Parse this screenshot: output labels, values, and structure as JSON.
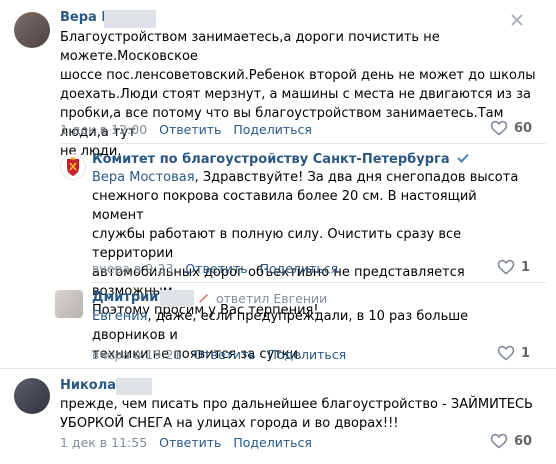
{
  "comments": [
    {
      "author": "Вера М",
      "text_lines": [
        "Благоустройством занимаетесь,а дороги почистить не можете.Московское",
        "шоссе пос.ленсоветовский.Ребенок второй день не может до школы",
        "доехать.Люди стоят мерзнут, а машины с места не двигаются из за",
        "пробки,а все потому что вы благоустройством занимаетесь.Там люди,а тут",
        "не люди."
      ],
      "date": "1 дек в 12:00",
      "reply_label": "Ответить",
      "share_label": "Поделиться",
      "likes": "60"
    },
    {
      "author": "Комитет по благоустройству Санкт-Петербурга",
      "verified": true,
      "address": "Вера Мостовая",
      "text_lines": [
        ", Здравствуйте! За два дня снегопадов высота",
        "снежного покрова составила более 20 см. В настоящий момент",
        "службы работают в полную силу. Очистить сразу все территории",
        "автомобильных дорог объективно не представляется возможным.",
        "Поэтому просим у Вас терпения!"
      ],
      "date": "вчера в 9:23",
      "reply_label": "Ответить",
      "share_label": "Поделиться",
      "likes": "1"
    },
    {
      "author": "Дмитрий Л",
      "replied_to": "ответил Евгении",
      "address": "Евгения",
      "text_lines": [
        ", даже, если предупреждали, в 10 раз больше дворников и",
        "техники не появится за сутки."
      ],
      "date": "вчера в 19:21",
      "reply_label": "Ответить",
      "share_label": "Поделиться",
      "likes": "1"
    },
    {
      "author": "Николай",
      "text_lines": [
        "прежде, чем писать про дальнейшее благоустройство - ЗАЙМИТЕСЬ",
        "УБОРКОЙ СНЕГА на улицах города и во дворах!!!"
      ],
      "date": "1 дек в 11:55",
      "reply_label": "Ответить",
      "share_label": "Поделиться",
      "likes": "60"
    }
  ],
  "colors": {
    "link": "#2a5885",
    "meta": "#818c99",
    "verified": "#5181b8"
  }
}
